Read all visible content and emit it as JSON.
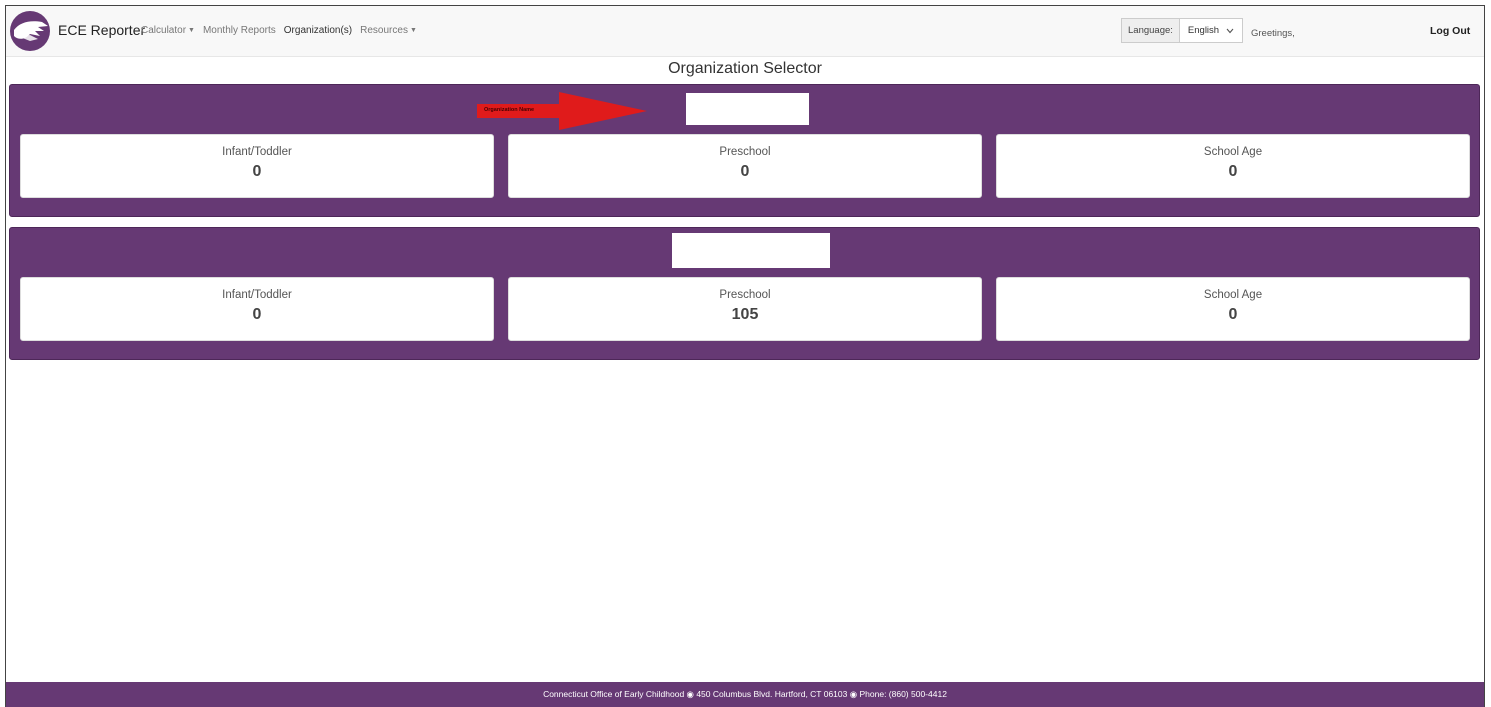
{
  "navbar": {
    "brand": "ECE Reporter",
    "links": [
      {
        "label": "Calculator",
        "dropdown": true
      },
      {
        "label": "Monthly Reports",
        "dropdown": false
      },
      {
        "label": "Organization(s)",
        "dropdown": false,
        "active": true
      },
      {
        "label": "Resources",
        "dropdown": true
      }
    ],
    "language_label": "Language:",
    "language_value": "English",
    "greeting": "Greetings,",
    "logout": "Log Out"
  },
  "page_title": "Organization Selector",
  "annotation": {
    "text": "Organization Name",
    "color": "#e01b1b"
  },
  "organizations": [
    {
      "name": "",
      "counts": [
        {
          "label": "Infant/Toddler",
          "value": "0"
        },
        {
          "label": "Preschool",
          "value": "0"
        },
        {
          "label": "School Age",
          "value": "0"
        }
      ]
    },
    {
      "name": "",
      "counts": [
        {
          "label": "Infant/Toddler",
          "value": "0"
        },
        {
          "label": "Preschool",
          "value": "105"
        },
        {
          "label": "School Age",
          "value": "0"
        }
      ]
    }
  ],
  "footer": "Connecticut Office of Early Childhood ◉ 450 Columbus Blvd. Hartford, CT 06103 ◉ Phone: (860) 500-4412",
  "colors": {
    "brand_purple": "#663974",
    "annotation_red": "#e01b1b"
  }
}
